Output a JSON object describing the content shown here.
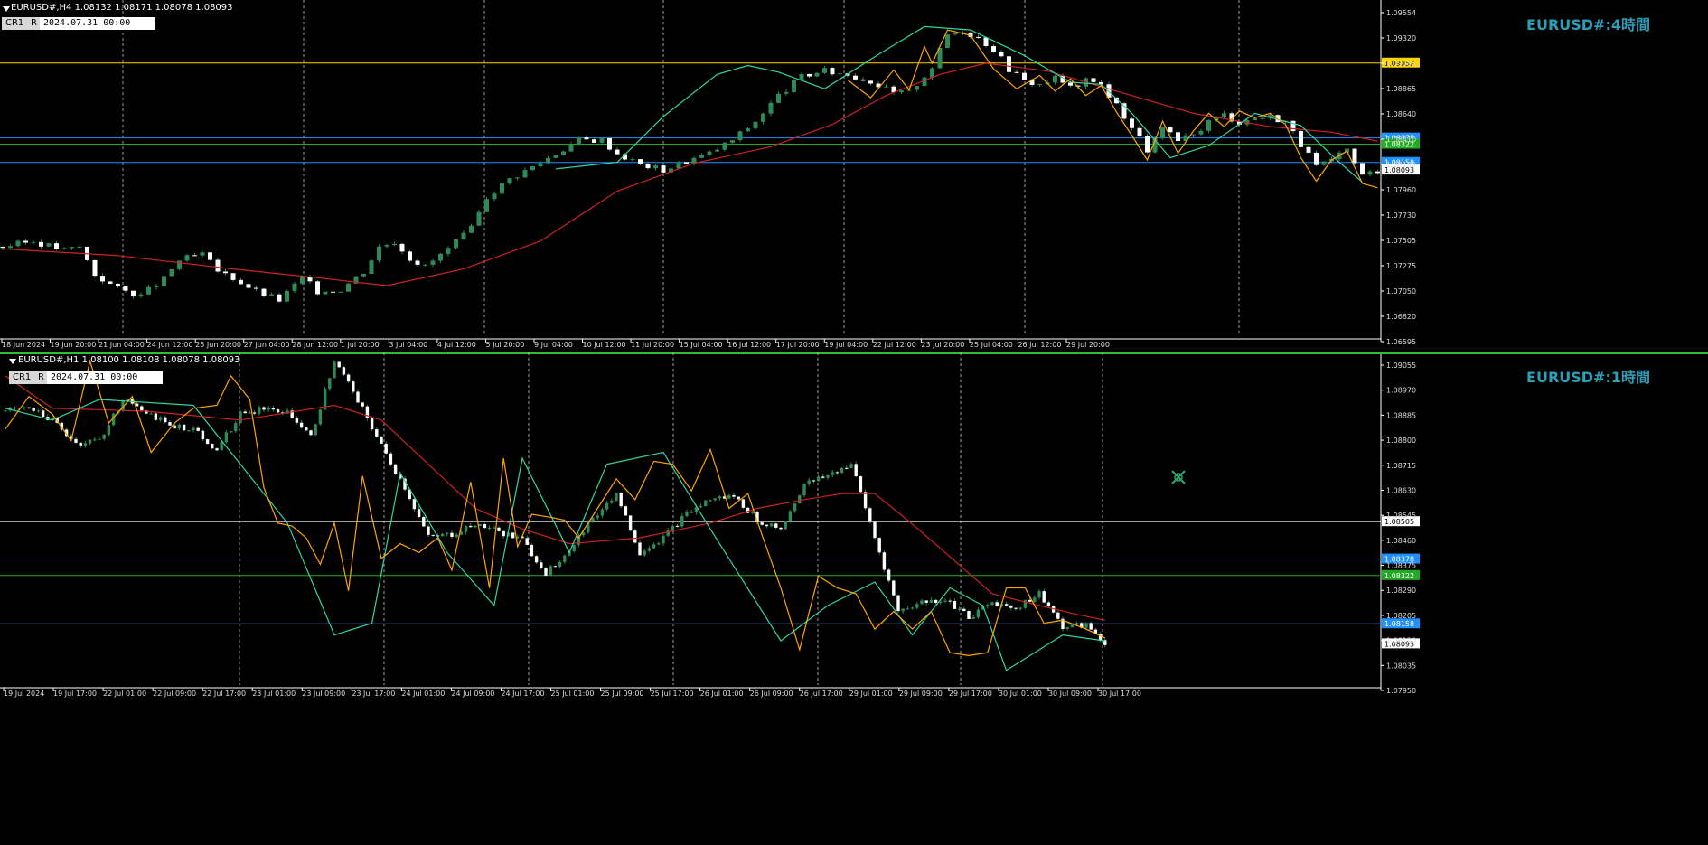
{
  "panels": [
    {
      "header": "EURUSD#,H4  1.08132 1.08171 1.08078 1.08093",
      "tag_cr": "CR1",
      "tag_r": "R",
      "tag_date": "2024.07.31  00:00",
      "title": "EURUSD#:4時間"
    },
    {
      "header": "EURUSD#,H1  1.08100 1.08108 1.08078 1.08093",
      "tag_cr": "CR1",
      "tag_r": "R",
      "tag_date": "2024.07.31  00:00",
      "title": "EURUSD#:1時間"
    }
  ],
  "colors": {
    "background": "#000000",
    "bull": "#2e8b57",
    "bear": "#ffffff",
    "wick": "#2e8b57",
    "ma": "#cc2222",
    "zigzag_fast": "#ffa500",
    "zigzag_slow": "#2fd6a7",
    "grid": "#c8c8c8",
    "blue_level": "#1e90ff",
    "green_level": "#22aa22",
    "yellow_level": "#ffd400",
    "white_level": "#ffffff",
    "title": "#2a9fb8"
  },
  "chart_data": [
    {
      "type": "candlestick",
      "timeframe": "H4",
      "ylim": [
        1.06595,
        1.09554
      ],
      "y_ticks": [
        "1.09554",
        "1.09320",
        "1.09085",
        "1.08865",
        "1.08640",
        "1.08410",
        "1.08190",
        "1.07960",
        "1.07730",
        "1.07505",
        "1.07275",
        "1.07050",
        "1.06820",
        "1.06595"
      ],
      "x_tick_labels": [
        "18 Jun 2024",
        "19 Jun 20:00",
        "21 Jun 04:00",
        "24 Jun 12:00",
        "25 Jun 20:00",
        "27 Jun 04:00",
        "28 Jun 12:00",
        "1 Jul 20:00",
        "3 Jul 04:00",
        "4 Jul 12:00",
        "5 Jul 20:00",
        "9 Jul 04:00",
        "10 Jul 12:00",
        "11 Jul 20:00",
        "15 Jul 04:00",
        "16 Jul 12:00",
        "17 Jul 20:00",
        "19 Jul 04:00",
        "22 Jul 12:00",
        "23 Jul 20:00",
        "25 Jul 04:00",
        "26 Jul 12:00",
        "29 Jul 20:00"
      ],
      "close_path": [
        [
          0,
          1.074
        ],
        [
          4,
          1.0745
        ],
        [
          8,
          1.0737
        ],
        [
          10,
          1.074
        ],
        [
          12,
          1.0715
        ],
        [
          15,
          1.0702
        ],
        [
          18,
          1.0696
        ],
        [
          21,
          1.0711
        ],
        [
          23,
          1.0728
        ],
        [
          26,
          1.0733
        ],
        [
          28,
          1.0718
        ],
        [
          30,
          1.0712
        ],
        [
          33,
          1.07
        ],
        [
          36,
          1.0692
        ],
        [
          39,
          1.0712
        ],
        [
          41,
          1.07
        ],
        [
          44,
          1.0702
        ],
        [
          47,
          1.0718
        ],
        [
          49,
          1.074
        ],
        [
          51,
          1.0745
        ],
        [
          53,
          1.073
        ],
        [
          55,
          1.0722
        ],
        [
          58,
          1.0738
        ],
        [
          61,
          1.0756
        ],
        [
          63,
          1.0785
        ],
        [
          66,
          1.0801
        ],
        [
          69,
          1.0812
        ],
        [
          72,
          1.0824
        ],
        [
          75,
          1.0836
        ],
        [
          78,
          1.0836
        ],
        [
          80,
          1.0824
        ],
        [
          83,
          1.0814
        ],
        [
          86,
          1.0809
        ],
        [
          89,
          1.0817
        ],
        [
          92,
          1.0824
        ],
        [
          95,
          1.0836
        ],
        [
          98,
          1.0853
        ],
        [
          101,
          1.0876
        ],
        [
          104,
          1.0893
        ],
        [
          107,
          1.0898
        ],
        [
          110,
          1.0895
        ],
        [
          113,
          1.0889
        ],
        [
          116,
          1.0878
        ],
        [
          118,
          1.0879
        ],
        [
          121,
          1.0902
        ],
        [
          123,
          1.0931
        ],
        [
          125,
          1.0935
        ],
        [
          127,
          1.0928
        ],
        [
          129,
          1.0918
        ],
        [
          131,
          1.09
        ],
        [
          133,
          1.0889
        ],
        [
          135,
          1.0886
        ],
        [
          137,
          1.0892
        ],
        [
          139,
          1.0883
        ],
        [
          141,
          1.0889
        ],
        [
          143,
          1.0886
        ],
        [
          145,
          1.0867
        ],
        [
          147,
          1.0848
        ],
        [
          149,
          1.0827
        ],
        [
          151,
          1.0846
        ],
        [
          153,
          1.0835
        ],
        [
          155,
          1.084
        ],
        [
          157,
          1.0853
        ],
        [
          159,
          1.0859
        ],
        [
          161,
          1.0852
        ],
        [
          163,
          1.0856
        ],
        [
          165,
          1.0857
        ],
        [
          167,
          1.0853
        ],
        [
          169,
          1.0832
        ],
        [
          171,
          1.0812
        ],
        [
          173,
          1.0817
        ],
        [
          175,
          1.0827
        ],
        [
          177,
          1.0804
        ],
        [
          179,
          1.0809
        ]
      ],
      "ma_path": [
        [
          0,
          1.0738
        ],
        [
          15,
          1.0732
        ],
        [
          30,
          1.072
        ],
        [
          41,
          1.0712
        ],
        [
          50,
          1.0705
        ],
        [
          60,
          1.072
        ],
        [
          70,
          1.0745
        ],
        [
          80,
          1.079
        ],
        [
          90,
          1.0815
        ],
        [
          100,
          1.083
        ],
        [
          108,
          1.085
        ],
        [
          115,
          1.0876
        ],
        [
          122,
          1.0895
        ],
        [
          128,
          1.0905
        ],
        [
          136,
          1.0898
        ],
        [
          145,
          1.088
        ],
        [
          155,
          1.086
        ],
        [
          165,
          1.0848
        ],
        [
          173,
          1.0843
        ],
        [
          179,
          1.0835
        ]
      ],
      "zigzag_fast": [
        [
          110,
          1.089
        ],
        [
          113,
          1.0874
        ],
        [
          116,
          1.0899
        ],
        [
          118,
          1.0881
        ],
        [
          120,
          1.092
        ],
        [
          121,
          1.0905
        ],
        [
          123,
          1.0935
        ],
        [
          126,
          1.093
        ],
        [
          129,
          1.09
        ],
        [
          132,
          1.0882
        ],
        [
          135,
          1.0894
        ],
        [
          137,
          1.088
        ],
        [
          139,
          1.0891
        ],
        [
          141,
          1.0876
        ],
        [
          143,
          1.0885
        ],
        [
          145,
          1.0861
        ],
        [
          147,
          1.084
        ],
        [
          149,
          1.0818
        ],
        [
          151,
          1.0853
        ],
        [
          153,
          1.0824
        ],
        [
          155,
          1.0844
        ],
        [
          157,
          1.086
        ],
        [
          159,
          1.0848
        ],
        [
          161,
          1.0862
        ],
        [
          163,
          1.0856
        ],
        [
          165,
          1.086
        ],
        [
          167,
          1.085
        ],
        [
          169,
          1.082
        ],
        [
          171,
          1.0799
        ],
        [
          173,
          1.0818
        ],
        [
          175,
          1.0826
        ],
        [
          177,
          1.0797
        ],
        [
          179,
          1.0793
        ]
      ],
      "zigzag_slow": [
        [
          72,
          1.081
        ],
        [
          80,
          1.0816
        ],
        [
          86,
          1.0857
        ],
        [
          93,
          1.0895
        ],
        [
          97,
          1.0903
        ],
        [
          101,
          1.0897
        ],
        [
          107,
          1.0882
        ],
        [
          114,
          1.0913
        ],
        [
          120,
          1.0938
        ],
        [
          126,
          1.0935
        ],
        [
          133,
          1.0912
        ],
        [
          139,
          1.0888
        ],
        [
          143,
          1.0886
        ],
        [
          147,
          1.086
        ],
        [
          152,
          1.082
        ],
        [
          157,
          1.0831
        ],
        [
          163,
          1.086
        ],
        [
          169,
          1.0849
        ],
        [
          174,
          1.0816
        ],
        [
          177,
          1.0798
        ]
      ],
      "levels": [
        {
          "price": 1.09052,
          "color": "#ffd400",
          "label": "1.09052"
        },
        {
          "price": 1.08378,
          "color": "#1e90ff",
          "label": "1.08378"
        },
        {
          "price": 1.08322,
          "color": "#22aa22",
          "label": "1.08322"
        },
        {
          "price": 1.08158,
          "color": "#1e90ff",
          "label": "1.08158"
        }
      ],
      "current_price": "1.08093"
    },
    {
      "type": "candlestick",
      "timeframe": "H1",
      "ylim": [
        1.0795,
        1.09055
      ],
      "y_ticks": [
        "1.09055",
        "1.08970",
        "1.08885",
        "1.08800",
        "1.08715",
        "1.08630",
        "1.08545",
        "1.08460",
        "1.08375",
        "1.08290",
        "1.08205",
        "1.08120",
        "1.08035",
        "1.07950"
      ],
      "x_tick_labels": [
        "19 Jul 2024",
        "19 Jul 17:00",
        "22 Jul 01:00",
        "22 Jul 09:00",
        "22 Jul 17:00",
        "23 Jul 01:00",
        "23 Jul 09:00",
        "23 Jul 17:00",
        "24 Jul 01:00",
        "24 Jul 09:00",
        "24 Jul 17:00",
        "25 Jul 01:00",
        "25 Jul 09:00",
        "25 Jul 17:00",
        "26 Jul 01:00",
        "26 Jul 09:00",
        "26 Jul 17:00",
        "29 Jul 01:00",
        "29 Jul 09:00",
        "29 Jul 17:00",
        "30 Jul 01:00",
        "30 Jul 09:00",
        "30 Jul 17:00"
      ],
      "close_path": [
        [
          0,
          1.0888
        ],
        [
          5,
          1.089
        ],
        [
          10,
          1.0885
        ],
        [
          15,
          1.0877
        ],
        [
          20,
          1.0878
        ],
        [
          25,
          1.0892
        ],
        [
          30,
          1.0888
        ],
        [
          35,
          1.0883
        ],
        [
          40,
          1.0882
        ],
        [
          45,
          1.0875
        ],
        [
          50,
          1.0887
        ],
        [
          55,
          1.0889
        ],
        [
          60,
          1.0888
        ],
        [
          65,
          1.0879
        ],
        [
          70,
          1.0905
        ],
        [
          75,
          1.0892
        ],
        [
          80,
          1.0876
        ],
        [
          85,
          1.0862
        ],
        [
          90,
          1.0845
        ],
        [
          95,
          1.0846
        ],
        [
          100,
          1.085
        ],
        [
          105,
          1.0847
        ],
        [
          110,
          1.0844
        ],
        [
          115,
          1.0833
        ],
        [
          120,
          1.0841
        ],
        [
          125,
          1.0852
        ],
        [
          130,
          1.086
        ],
        [
          135,
          1.084
        ],
        [
          140,
          1.0845
        ],
        [
          145,
          1.0853
        ],
        [
          150,
          1.0858
        ],
        [
          155,
          1.0859
        ],
        [
          160,
          1.0851
        ],
        [
          165,
          1.0848
        ],
        [
          170,
          1.0863
        ],
        [
          175,
          1.0866
        ],
        [
          180,
          1.087
        ],
        [
          185,
          1.0845
        ],
        [
          190,
          1.082
        ],
        [
          195,
          1.0823
        ],
        [
          200,
          1.0824
        ],
        [
          205,
          1.0818
        ],
        [
          210,
          1.0823
        ],
        [
          215,
          1.0821
        ],
        [
          220,
          1.0826
        ],
        [
          225,
          1.0815
        ],
        [
          230,
          1.0815
        ],
        [
          234,
          1.0809
        ]
      ],
      "ma_path": [
        [
          0,
          1.09
        ],
        [
          10,
          1.0889
        ],
        [
          30,
          1.0888
        ],
        [
          50,
          1.0885
        ],
        [
          70,
          1.089
        ],
        [
          80,
          1.0885
        ],
        [
          90,
          1.087
        ],
        [
          100,
          1.0855
        ],
        [
          110,
          1.0848
        ],
        [
          120,
          1.0843
        ],
        [
          135,
          1.0845
        ],
        [
          150,
          1.085
        ],
        [
          160,
          1.0855
        ],
        [
          170,
          1.0858
        ],
        [
          178,
          1.086
        ],
        [
          185,
          1.086
        ],
        [
          192,
          1.0851
        ],
        [
          200,
          1.084
        ],
        [
          210,
          1.0826
        ],
        [
          220,
          1.0822
        ],
        [
          228,
          1.0819
        ],
        [
          234,
          1.0817
        ]
      ],
      "zigzag_fast": [
        [
          0,
          1.0882
        ],
        [
          5,
          1.0893
        ],
        [
          10,
          1.0887
        ],
        [
          14,
          1.0878
        ],
        [
          18,
          1.0905
        ],
        [
          22,
          1.0884
        ],
        [
          27,
          1.0893
        ],
        [
          31,
          1.0874
        ],
        [
          36,
          1.0884
        ],
        [
          40,
          1.0889
        ],
        [
          45,
          1.089
        ],
        [
          48,
          1.09
        ],
        [
          52,
          1.0892
        ],
        [
          55,
          1.0862
        ],
        [
          58,
          1.085
        ],
        [
          61,
          1.0849
        ],
        [
          64,
          1.0845
        ],
        [
          67,
          1.0836
        ],
        [
          70,
          1.085
        ],
        [
          73,
          1.0827
        ],
        [
          76,
          1.0866
        ],
        [
          80,
          1.0838
        ],
        [
          84,
          1.0843
        ],
        [
          88,
          1.084
        ],
        [
          92,
          1.0845
        ],
        [
          95,
          1.0834
        ],
        [
          99,
          1.0864
        ],
        [
          103,
          1.0828
        ],
        [
          106,
          1.0872
        ],
        [
          109,
          1.0842
        ],
        [
          112,
          1.0853
        ],
        [
          116,
          1.0852
        ],
        [
          119,
          1.0851
        ],
        [
          122,
          1.0845
        ],
        [
          126,
          1.0855
        ],
        [
          130,
          1.0865
        ],
        [
          134,
          1.0858
        ],
        [
          138,
          1.0871
        ],
        [
          142,
          1.087
        ],
        [
          146,
          1.0861
        ],
        [
          150,
          1.0875
        ],
        [
          154,
          1.0855
        ],
        [
          158,
          1.086
        ],
        [
          161,
          1.0846
        ],
        [
          165,
          1.0828
        ],
        [
          169,
          1.0807
        ],
        [
          173,
          1.0832
        ],
        [
          177,
          1.0828
        ],
        [
          181,
          1.0826
        ],
        [
          185,
          1.0814
        ],
        [
          189,
          1.082
        ],
        [
          193,
          1.0814
        ],
        [
          197,
          1.082
        ],
        [
          201,
          1.0806
        ],
        [
          205,
          1.0805
        ],
        [
          209,
          1.0806
        ],
        [
          213,
          1.0828
        ],
        [
          217,
          1.0828
        ],
        [
          221,
          1.0816
        ],
        [
          225,
          1.0817
        ],
        [
          230,
          1.0814
        ],
        [
          234,
          1.0811
        ]
      ],
      "zigzag_slow": [
        [
          0,
          1.0889
        ],
        [
          10,
          1.0885
        ],
        [
          20,
          1.0892
        ],
        [
          40,
          1.089
        ],
        [
          60,
          1.085
        ],
        [
          70,
          1.0812
        ],
        [
          78,
          1.0816
        ],
        [
          84,
          1.0867
        ],
        [
          94,
          1.084
        ],
        [
          104,
          1.0822
        ],
        [
          110,
          1.0872
        ],
        [
          120,
          1.084
        ],
        [
          128,
          1.087
        ],
        [
          140,
          1.0874
        ],
        [
          150,
          1.0848
        ],
        [
          165,
          1.081
        ],
        [
          175,
          1.0822
        ],
        [
          185,
          1.083
        ],
        [
          193,
          1.0812
        ],
        [
          201,
          1.0828
        ],
        [
          208,
          1.0822
        ],
        [
          213,
          1.08
        ],
        [
          225,
          1.0812
        ],
        [
          234,
          1.081
        ]
      ],
      "levels": [
        {
          "price": 1.08505,
          "color": "#ffffff",
          "label": "1.08505"
        },
        {
          "price": 1.08378,
          "color": "#1e90ff",
          "label": "1.08378"
        },
        {
          "price": 1.08322,
          "color": "#22aa22",
          "label": "1.08322"
        },
        {
          "price": 1.08158,
          "color": "#1e90ff",
          "label": "1.08158"
        }
      ],
      "current_price": "1.08093"
    }
  ]
}
